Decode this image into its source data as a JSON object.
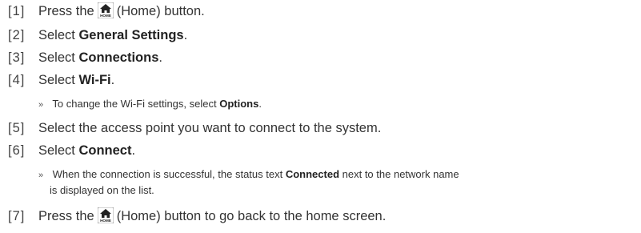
{
  "steps": [
    {
      "num": "[1]",
      "pre": "Press the",
      "post": "(Home) button."
    },
    {
      "num": "[2]",
      "pre": "Select",
      "bold": "General Settings",
      "post": "."
    },
    {
      "num": "[3]",
      "pre": "Select",
      "bold": "Connections",
      "post": "."
    },
    {
      "num": "[4]",
      "pre": "Select",
      "bold": "Wi-Fi",
      "post": "."
    },
    {
      "num": "[5]",
      "text": "Select the access point you want to connect to the system."
    },
    {
      "num": "[6]",
      "pre": "Select",
      "bold": "Connect",
      "post": "."
    },
    {
      "num": "[7]",
      "pre": "Press the",
      "post": "(Home) button to go back to the home screen."
    }
  ],
  "notes": [
    {
      "mark": "»",
      "pre": "To change the Wi-Fi settings, select",
      "bold": "Options",
      "post": "."
    },
    {
      "mark": "»",
      "pre": "When the connection is successful, the status text",
      "bold": "Connected",
      "post": "next to the network name",
      "cont": "is displayed on the list."
    }
  ],
  "icons": {
    "home_label": "HOME"
  }
}
